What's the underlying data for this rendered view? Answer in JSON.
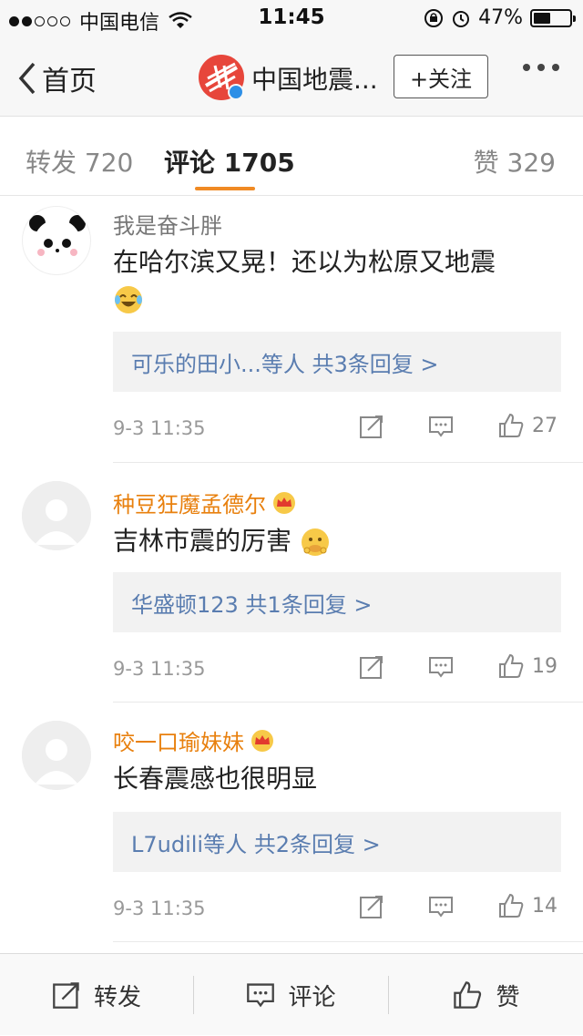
{
  "status_bar": {
    "carrier": "中国电信",
    "time": "11:45",
    "battery": "47%",
    "battery_level": 0.47
  },
  "nav": {
    "back_label": "首页",
    "title": "中国地震...",
    "follow_label": "+关注"
  },
  "tabs": [
    {
      "label": "转发 720"
    },
    {
      "label": "评论 1705"
    },
    {
      "label": "赞 329"
    }
  ],
  "comments": [
    {
      "name": "我是奋斗胖",
      "text": "在哈尔滨又晃！还以为松原又地震",
      "reply": "可乐的田小...等人  共3条回复 >",
      "time": "9-3 11:35",
      "likes": "27"
    },
    {
      "name": "种豆狂魔孟德尔",
      "text": "吉林市震的厉害",
      "reply": "华盛顿123  共1条回复 >",
      "time": "9-3 11:35",
      "likes": "19"
    },
    {
      "name": "咬一口瑜妹妹",
      "text": "长春震感也很明显",
      "reply": "L7udili等人  共2条回复 >",
      "time": "9-3 11:35",
      "likes": "14"
    }
  ],
  "toolbar": {
    "repost": "转发",
    "comment": "评论",
    "like": "赞"
  },
  "colors": {
    "accent": "#f08a24",
    "vip_name": "#e8800e",
    "link": "#5a7db0"
  }
}
